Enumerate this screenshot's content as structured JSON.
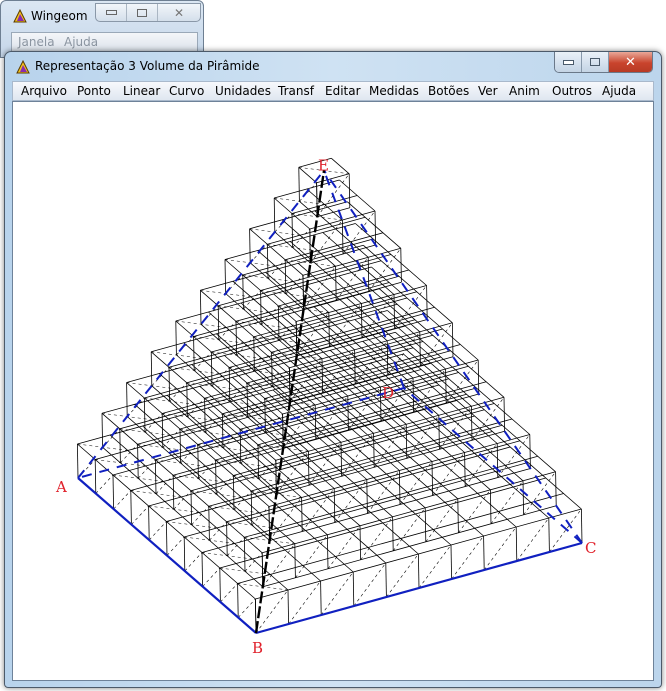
{
  "background_window": {
    "title": "Wingeom",
    "icon": "wingeom-triangle-icon",
    "menu": [
      "Janela",
      "Ajuda"
    ],
    "controls": [
      "minimize",
      "maximize",
      "close"
    ]
  },
  "main_window": {
    "title": "Representação 3 Volume da Pirâmide",
    "icon": "wingeom-triangle-icon",
    "controls": [
      "minimize",
      "maximize",
      "close"
    ],
    "menu": [
      "Arquivo",
      "Ponto",
      "Linear",
      "Curvo",
      "Unidades",
      "Transf",
      "Editar",
      "Medidas",
      "Botões",
      "Ver",
      "Anim",
      "Outros",
      "Ajuda"
    ]
  },
  "scene": {
    "description": "Stepped pyramid of unit cubes approximating a square pyramid",
    "layers": 10,
    "base_size": 10,
    "points": [
      {
        "name": "A",
        "role": "base-corner"
      },
      {
        "name": "B",
        "role": "base-corner"
      },
      {
        "name": "C",
        "role": "base-corner"
      },
      {
        "name": "D",
        "role": "base-corner"
      },
      {
        "name": "E",
        "role": "apex"
      }
    ],
    "colors": {
      "cube_edges": "#000000",
      "pyramid_edges": "#1020c0",
      "point_labels": "#e0202a"
    }
  }
}
